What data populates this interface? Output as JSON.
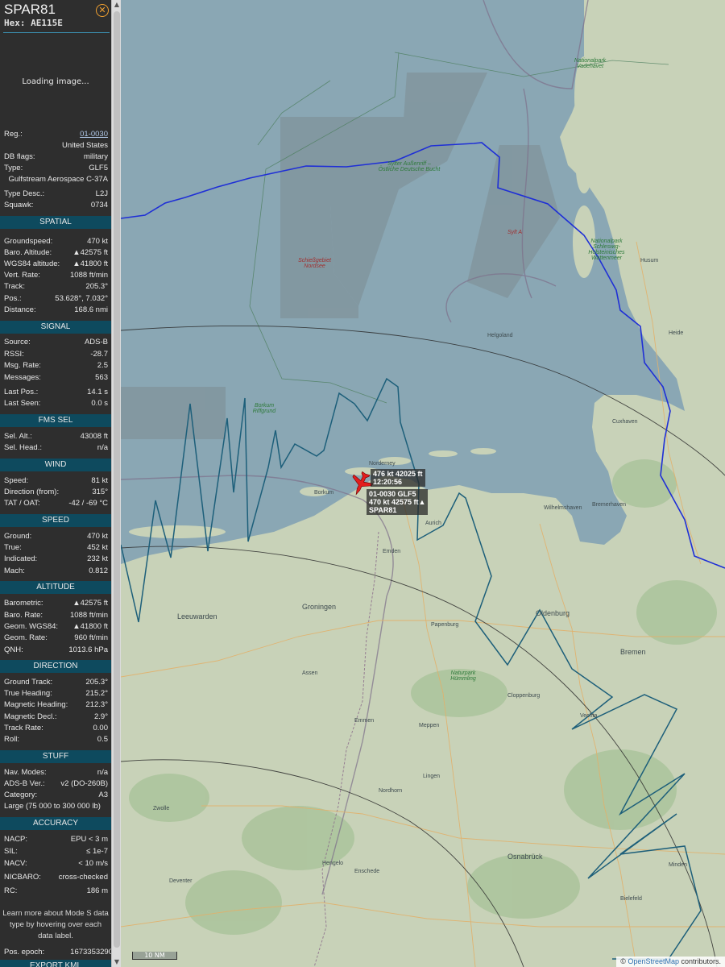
{
  "aircraft": {
    "callsign": "SPAR81",
    "hex_label": "Hex:",
    "hex": "AE115E",
    "loading_text": "Loading image...",
    "close_icon": "close-icon"
  },
  "details": [
    {
      "label": "Reg.:",
      "value": "01-0030"
    },
    {
      "label": "",
      "value": "United States"
    },
    {
      "label": "DB flags:",
      "value": "military"
    },
    {
      "label": "Type:",
      "value": "GLF5"
    },
    {
      "label": "",
      "value": "Gulfstream Aerospace C-37A"
    },
    {
      "label": "Type Desc.:",
      "value": "L2J"
    },
    {
      "label": "Squawk:",
      "value": "0734"
    }
  ],
  "sections": {
    "spatial": {
      "title": "SPATIAL",
      "rows": [
        {
          "label": "Groundspeed:",
          "value": "470 kt"
        },
        {
          "label": "Baro. Altitude:",
          "value": "▲42575 ft"
        },
        {
          "label": "WGS84 altitude:",
          "value": "▲41800 ft"
        },
        {
          "label": "Vert. Rate:",
          "value": "1088 ft/min"
        },
        {
          "label": "Track:",
          "value": "205.3°"
        },
        {
          "label": "Pos.:",
          "value": "53.628°, 7.032°"
        },
        {
          "label": "Distance:",
          "value": "168.6 nmi"
        }
      ]
    },
    "signal": {
      "title": "SIGNAL",
      "rows": [
        {
          "label": "Source:",
          "value": "ADS-B"
        },
        {
          "label": "RSSI:",
          "value": "-28.7"
        },
        {
          "label": "Msg. Rate:",
          "value": "2.5"
        },
        {
          "label": "Messages:",
          "value": "563"
        },
        {
          "label": "Last Pos.:",
          "value": "14.1 s"
        },
        {
          "label": "Last Seen:",
          "value": "0.0 s"
        }
      ]
    },
    "fms": {
      "title": "FMS SEL",
      "rows": [
        {
          "label": "Sel. Alt.:",
          "value": "43008 ft"
        },
        {
          "label": "Sel. Head.:",
          "value": "n/a"
        }
      ]
    },
    "wind": {
      "title": "WIND",
      "rows": [
        {
          "label": "Speed:",
          "value": "81 kt"
        },
        {
          "label": "Direction (from):",
          "value": "315°"
        },
        {
          "label": "TAT / OAT:",
          "value": "-42 / -69 °C"
        }
      ]
    },
    "speed": {
      "title": "SPEED",
      "rows": [
        {
          "label": "Ground:",
          "value": "470 kt"
        },
        {
          "label": "True:",
          "value": "452 kt"
        },
        {
          "label": "Indicated:",
          "value": "232 kt"
        },
        {
          "label": "Mach:",
          "value": "0.812"
        }
      ]
    },
    "altitude": {
      "title": "ALTITUDE",
      "rows": [
        {
          "label": "Barometric:",
          "value": "▲42575 ft"
        },
        {
          "label": "Baro. Rate:",
          "value": "1088 ft/min"
        },
        {
          "label": "Geom. WGS84:",
          "value": "▲41800 ft"
        },
        {
          "label": "Geom. Rate:",
          "value": "960 ft/min"
        },
        {
          "label": "QNH:",
          "value": "1013.6 hPa"
        }
      ]
    },
    "direction": {
      "title": "DIRECTION",
      "rows": [
        {
          "label": "Ground Track:",
          "value": "205.3°"
        },
        {
          "label": "True Heading:",
          "value": "215.2°"
        },
        {
          "label": "Magnetic Heading:",
          "value": "212.3°"
        },
        {
          "label": "Magnetic Decl.:",
          "value": "2.9°"
        },
        {
          "label": "Track Rate:",
          "value": "0.00"
        },
        {
          "label": "Roll:",
          "value": "0.5"
        }
      ]
    },
    "stuff": {
      "title": "STUFF",
      "rows": [
        {
          "label": "Nav. Modes:",
          "value": "n/a"
        },
        {
          "label": "ADS-B Ver.:",
          "value": "v2 (DO-260B)"
        },
        {
          "label": "Category:",
          "value": "A3"
        },
        {
          "label": "",
          "value": "Large (75 000 to 300 000 lb)"
        }
      ]
    },
    "accuracy": {
      "title": "ACCURACY",
      "rows": [
        {
          "label": "NACP:",
          "value": "EPU < 3 m"
        },
        {
          "label": "SIL:",
          "value": "≤ 1e-7"
        },
        {
          "label": "NACV:",
          "value": "< 10 m/s"
        },
        {
          "label": "NICBARO:",
          "value": "cross-checked"
        },
        {
          "label": "RC:",
          "value": "186 m"
        }
      ]
    }
  },
  "footer": {
    "note": "Learn more about Mode S data type by hovering over each data label.",
    "epoch_label": "Pos. epoch:",
    "epoch_value": "1673353290",
    "export_label": "EXPORT KML"
  },
  "map": {
    "aircraft_label": {
      "line1": "01-0030 GLF5",
      "line2": "470 kt  42575 ft▲",
      "line3": "SPAR81"
    },
    "hover_label": {
      "line1": "476 kt  42025 ft",
      "line2": "12:20:56"
    },
    "scale": "10 NM",
    "attribution_prefix": "© ",
    "attribution_link": "OpenStreetMap",
    "attribution_suffix": " contributors.",
    "place_labels": {
      "borkum": "Borkum",
      "norderney": "Norderney",
      "emden": "Emden",
      "aurich": "Aurich",
      "groningen": "Groningen",
      "leeuwarden": "Leeuwarden",
      "assen": "Assen",
      "emmen": "Emmen",
      "oldenburg": "Oldenburg",
      "bremen": "Bremen",
      "bremerhaven": "Bremerhaven",
      "wilhelmshaven": "Wilhelmshaven",
      "cuxhaven": "Cuxhaven",
      "osnabrueck": "Osnabrück",
      "enschede": "Enschede",
      "lingen": "Lingen",
      "meppen": "Meppen",
      "papenburg": "Papenburg",
      "husum": "Husum",
      "heide": "Heide",
      "vechta": "Vechta",
      "cloppenburg": "Cloppenburg",
      "nordhorn": "Nordhorn",
      "zwolle": "Zwolle",
      "deventer": "Deventer",
      "hengelo": "Hengelo",
      "bielefeld": "Bielefeld",
      "minden": "Minden",
      "helgoland": "Helgoland",
      "sylt": "Sylt A",
      "sylter": "Sylter Außenriff – Östliche Deutsche Bucht",
      "nationalpark_n": "Nationalpark Vadehavet",
      "nationalpark_sh": "Nationalpark Schleswig-Holsteinisches Wattenmeer",
      "schiessgebiet": "Schießgebiet Nordsee",
      "borkum_riff": "Borkum Riffgrund",
      "hummling": "Naturpark Hümmling"
    }
  }
}
